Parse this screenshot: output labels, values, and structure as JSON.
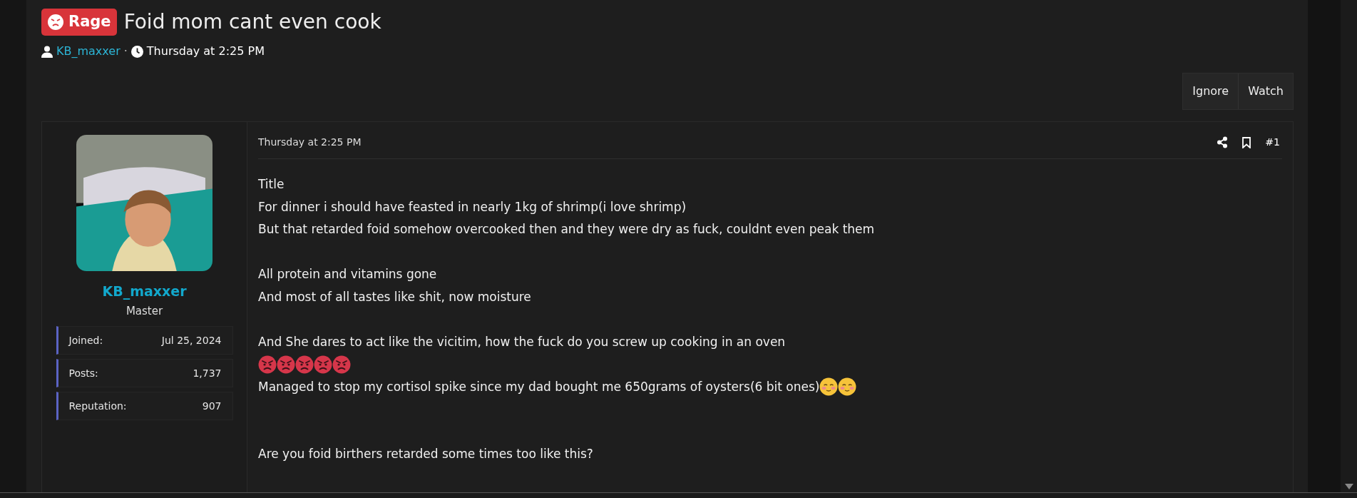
{
  "thread": {
    "prefix": "Rage",
    "title": "Foid mom cant even cook",
    "author": "KB_maxxer",
    "separator": "·",
    "date": "Thursday at 2:25 PM"
  },
  "actions": [
    "Ignore",
    "Watch"
  ],
  "post": {
    "user": {
      "name": "KB_maxxer",
      "rank": "Master",
      "stats": [
        {
          "label": "Joined:",
          "value": "Jul 25, 2024"
        },
        {
          "label": "Posts:",
          "value": "1,737"
        },
        {
          "label": "Reputation:",
          "value": "907"
        }
      ]
    },
    "date": "Thursday at 2:25 PM",
    "number": "#1",
    "body": [
      {
        "kind": "text",
        "text": "Title"
      },
      {
        "kind": "text",
        "text": "For dinner i should have feasted in nearly 1kg of shrimp(i love shrimp)"
      },
      {
        "kind": "text",
        "text": "But that retarded foid somehow overcooked then and they were dry as fuck, couldnt even peak them"
      },
      {
        "kind": "blank"
      },
      {
        "kind": "text",
        "text": "All protein and vitamins gone"
      },
      {
        "kind": "text",
        "text": "And most of all tastes like shit, now moisture"
      },
      {
        "kind": "blank"
      },
      {
        "kind": "text",
        "text": "And She dares to act like the vicitim, how the fuck do you screw up cooking in an oven"
      },
      {
        "kind": "emojis",
        "emojis": [
          {
            "kind": "angry"
          },
          {
            "kind": "angry"
          },
          {
            "kind": "angry"
          },
          {
            "kind": "angry"
          },
          {
            "kind": "angry"
          }
        ]
      },
      {
        "kind": "text",
        "text": "Managed to stop my cortisol spike since my dad bought me 650grams of oysters(6 bit ones)",
        "emojis": [
          {
            "kind": "blush"
          },
          {
            "kind": "blush"
          }
        ]
      },
      {
        "kind": "blank"
      },
      {
        "kind": "blank"
      },
      {
        "kind": "text",
        "text": "Are you foid birthers retarded some times too like this?"
      }
    ]
  }
}
